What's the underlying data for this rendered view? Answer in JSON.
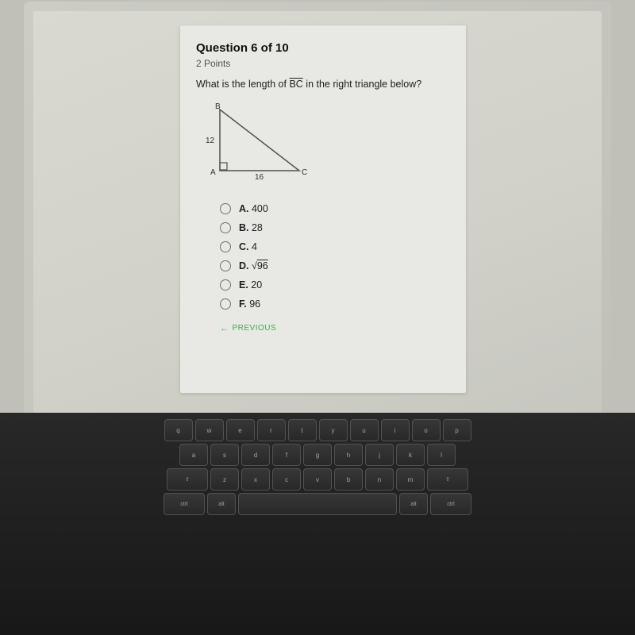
{
  "quiz": {
    "question_number": "Question 6 of 10",
    "points": "2 Points",
    "question_text_prefix": "What is the length of ",
    "segment_label": "BC",
    "question_text_suffix": " in the right triangle below?",
    "triangle": {
      "vertex_a_label": "A",
      "vertex_b_label": "B",
      "vertex_c_label": "C",
      "side_ab_length": "12",
      "side_ac_length": "16"
    },
    "answer_options": [
      {
        "letter": "A",
        "value": "400"
      },
      {
        "letter": "B",
        "value": "28"
      },
      {
        "letter": "C",
        "value": "4"
      },
      {
        "letter": "D",
        "value": "√96",
        "is_sqrt": true,
        "radicand": "96"
      },
      {
        "letter": "E",
        "value": "20"
      },
      {
        "letter": "F",
        "value": "96"
      }
    ],
    "previous_label": "← PREVIOUS"
  },
  "keyboard": {
    "rows": [
      [
        "q",
        "w",
        "e",
        "r",
        "t",
        "y",
        "u",
        "i",
        "o",
        "p"
      ],
      [
        "a",
        "s",
        "d",
        "f",
        "g",
        "h",
        "j",
        "k",
        "l"
      ],
      [
        "z",
        "x",
        "c",
        "v",
        "b",
        "n",
        "m"
      ]
    ]
  },
  "colors": {
    "accent_green": "#4CAF50",
    "text_dark": "#222222",
    "border_light": "#cccccc"
  }
}
